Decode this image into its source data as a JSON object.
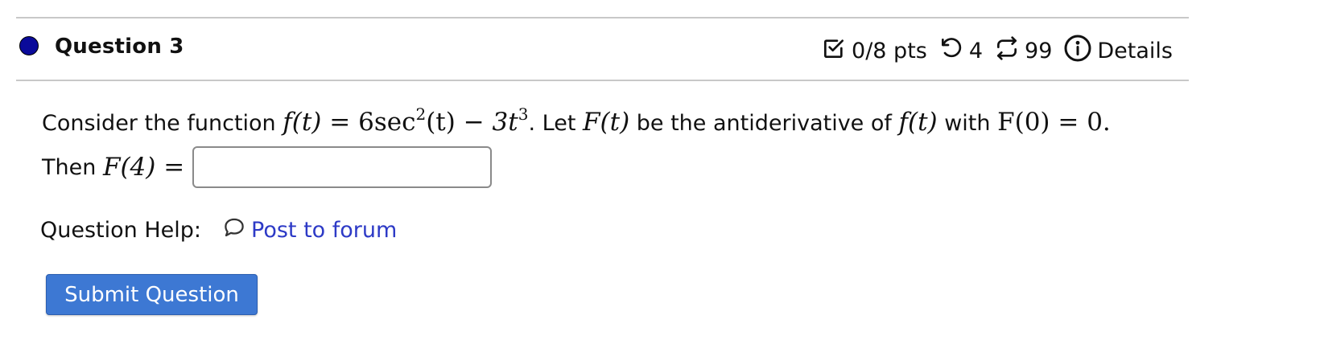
{
  "colors": {
    "status_dot": "#0a0a9a",
    "link": "#2d3ac6",
    "button_bg": "#3d78d3"
  },
  "question": {
    "title": "Question 3",
    "points": "0/8 pts",
    "attempts": "4",
    "tries": "99",
    "details_label": "Details"
  },
  "problem": {
    "intro": "Consider the function",
    "f_lhs": "f(t)",
    "eq": "=",
    "coef": "6",
    "sec": "sec",
    "exp2": "2",
    "arg": "(t)",
    "minus": "−",
    "term2": "3t",
    "exp3": "3",
    "period": ".",
    "let": "Let",
    "F_t": "F(t)",
    "be": "be the antiderivative of",
    "f_t": "f(t)",
    "with": "with",
    "F0": "F(0) = 0.",
    "then": "Then",
    "F4": "F(4) ="
  },
  "answer": {
    "value": "",
    "placeholder": ""
  },
  "help": {
    "label": "Question Help:",
    "post_link": "Post to forum"
  },
  "submit_label": "Submit Question"
}
